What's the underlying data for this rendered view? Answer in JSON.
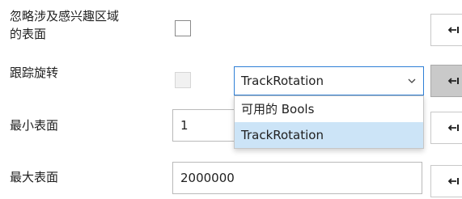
{
  "rows": {
    "ignore_surfaces": {
      "label_line1": "忽略涉及感兴趣区域",
      "label_line2": "的表面",
      "checked": false
    },
    "track_rotation": {
      "label": "跟踪旋转",
      "checked": false,
      "disabled": true,
      "combo_value": "TrackRotation"
    },
    "min_surface": {
      "label": "最小表面",
      "value": "1"
    },
    "max_surface": {
      "label": "最大表面",
      "value": "2000000"
    }
  },
  "dropdown": {
    "options": [
      {
        "label": "可用的 Bools",
        "selected": false
      },
      {
        "label": "TrackRotation",
        "selected": true
      }
    ]
  },
  "icons": {
    "bind": "left-arrow-from-bar-icon",
    "chevron": "chevron-down-icon"
  },
  "colors": {
    "focus_border": "#2e7fd6",
    "selected_item": "#cce4f7",
    "active_button": "#c9c9c9"
  }
}
